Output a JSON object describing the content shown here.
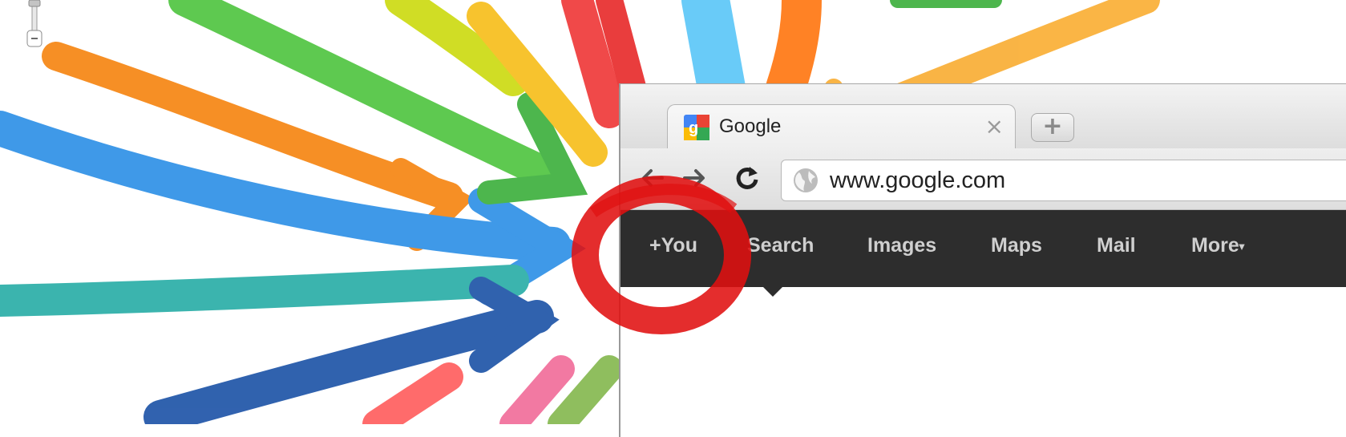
{
  "browser": {
    "tab": {
      "title": "Google",
      "close_glyph": "×",
      "favicon": "google-favicon-icon"
    },
    "new_tab_glyph": "+",
    "toolbar": {
      "back_icon": "back-arrow-icon",
      "forward_icon": "forward-arrow-icon",
      "reload_icon": "reload-icon"
    },
    "omnibox": {
      "url": "www.google.com",
      "icon": "globe-icon"
    }
  },
  "gbar": {
    "items": [
      {
        "label": "+You"
      },
      {
        "label": "Search"
      },
      {
        "label": "Images"
      },
      {
        "label": "Maps"
      },
      {
        "label": "Mail"
      },
      {
        "label": "More",
        "caret": "▾"
      }
    ]
  },
  "colors": {
    "gbar_bg": "#2d2d2d",
    "gbar_text": "#cfcfcf",
    "marker_red": "#e01010",
    "marker_blue": "#1565c0",
    "marker_green": "#3cbf2a",
    "marker_orange": "#f57c00",
    "marker_yellow": "#f6b90a",
    "marker_cyan": "#33b5e5"
  }
}
